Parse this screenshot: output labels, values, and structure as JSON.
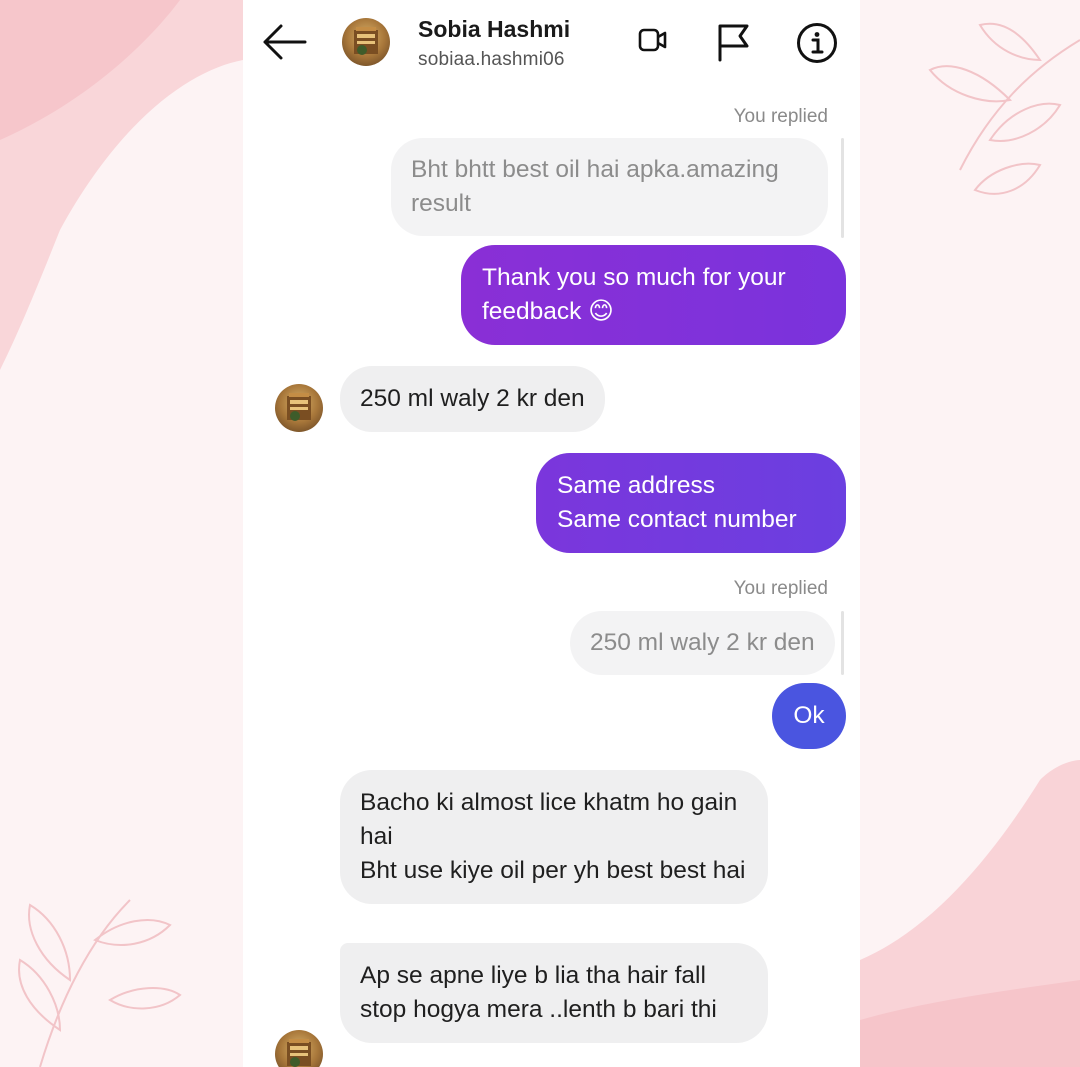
{
  "colors": {
    "sent_gradient_start": "#8a2fd6",
    "sent_gradient_end": "#6a3ee0",
    "ok_bubble": "#4a55e0",
    "background_pink": "#fdeff0",
    "accent_pink": "#f8c9cd"
  },
  "header": {
    "back_icon": "arrow-left-icon",
    "name": "Sobia Hashmi",
    "username": "sobiaa.hashmi06",
    "icons": [
      "video-call-icon",
      "flag-icon",
      "info-icon"
    ]
  },
  "messages": [
    {
      "type": "reply_label",
      "text": "You replied"
    },
    {
      "type": "quoted",
      "text": "Bht bhtt best oil hai apka.amazing result"
    },
    {
      "type": "sent",
      "text": "Thank you so much for your feedback 😊"
    },
    {
      "type": "received",
      "text": "250 ml waly 2 kr den"
    },
    {
      "type": "sent",
      "text": "Same address\nSame contact number"
    },
    {
      "type": "reply_label",
      "text": "You replied"
    },
    {
      "type": "quoted",
      "text": "250 ml waly 2 kr den"
    },
    {
      "type": "sent",
      "text": "Ok"
    },
    {
      "type": "received",
      "text": "Bacho ki almost lice khatm ho gain hai\nBht use kiye oil per yh best best hai"
    },
    {
      "type": "received",
      "text": "Ap se apne liye b lia tha hair fall stop hogya mera ..lenth b bari thi"
    }
  ]
}
